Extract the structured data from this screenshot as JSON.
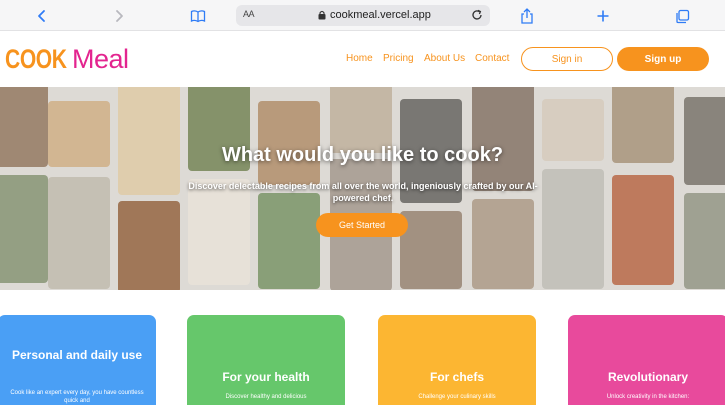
{
  "browser": {
    "url_prefix": "AA",
    "url": "cookmeal.vercel.app"
  },
  "nav": {
    "logo_cook": "COOK",
    "logo_meal": "Meal",
    "links": [
      "Home",
      "Pricing",
      "About Us",
      "Contact"
    ],
    "signin": "Sign in",
    "signup": "Sign up"
  },
  "hero": {
    "title": "What would you like to cook?",
    "subtitle": "Discover delectable recipes from all over the world, ingeniously crafted by our AI-powered chef.",
    "cta": "Get Started"
  },
  "cards": [
    {
      "title": "Personal and daily use",
      "desc": "Cook like an expert every day, you have countless quick and",
      "color": "#4a9ff5"
    },
    {
      "title": "For your health",
      "desc": "Discover healthy and delicious",
      "color": "#66c76b"
    },
    {
      "title": "For chefs",
      "desc": "Challenge your culinary skills",
      "color": "#fcb632"
    },
    {
      "title": "Revolutionary",
      "desc": "Unlock creativity in the kitchen:",
      "color": "#e84a9c"
    }
  ],
  "colors": {
    "accent": "#f7931e",
    "brand_pink": "#e3248f"
  }
}
